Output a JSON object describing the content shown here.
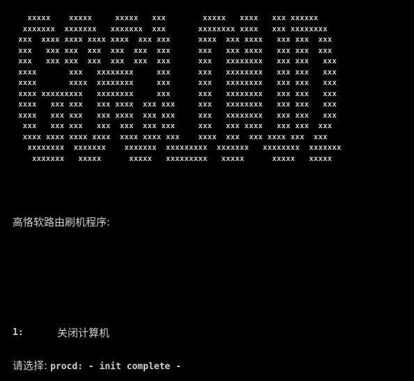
{
  "banner": {
    "lines": [
      "  xxxxx    xxxxx     xxxxx   xxx        xxxxx   xxxx   xxx xxxxxx",
      " xxxxxxx  xxxxxxx   xxxxxxx  xxx       xxxxxxxx xxxx   xxx xxxxxxxx",
      "xxx  xxxx xxxx xxxx xxxx  xxx xxx      xxxx  xxx xxxx   xxx xxx  xxx",
      "xxx   xxx xxx  xxx  xxx  xxx  xxx      xxx   xxx xxxx   xxx xxx  xxx",
      "xxx   xxx xxx  xxx  xxx  xxx  xxx      xxx   xxxxxxxx   xxx xxx   xxx",
      "xxxx       xxx   xxxxxxxx     xxx      xxx   xxxxxxxx   xxx xxx   xxx",
      "xxxx       xxxx  xxxxxxxx     xxx      xxx   xxxxxxxx   xxx xxx   xxx",
      "xxxx xxxxxxxxx   xxxxxxxx     xxx      xxx   xxxxxxxx   xxx xxx   xxx",
      "xxxx   xxx xxx   xxx xxxx  xxx xxx     xxx   xxxxxxxx   xxx xxx   xxx",
      "xxxx   xxx xxx   xxx xxxx  xxx xxx     xxx   xxxxxxxx   xxx xxx   xxx",
      " xxx   xxx xxx   xxx  xxx  xxx xxx     xxx   xxx xxxx   xxx xxx  xxx",
      " xxxx xxxx xxxx xxxx  xxxx xxxx xxx    xxxx  xxx  xxx xxxx xxx  xxx",
      "  xxxxxxxx  xxxxxxx    xxxxxxx  xxxxxxxxx  xxxxxxx   xxxxxxxx  xxxxxxx",
      "   xxxxxxx   xxxxx      xxxxx   xxxxxxxxx   xxxxx      xxxxx   xxxxx"
    ]
  },
  "title": "高恪软路由刷机程序:",
  "menu": [
    {
      "num": "1:",
      "label": "关闭计算机"
    }
  ],
  "prompt": "请选择:",
  "status_message": "procd: - init complete -"
}
